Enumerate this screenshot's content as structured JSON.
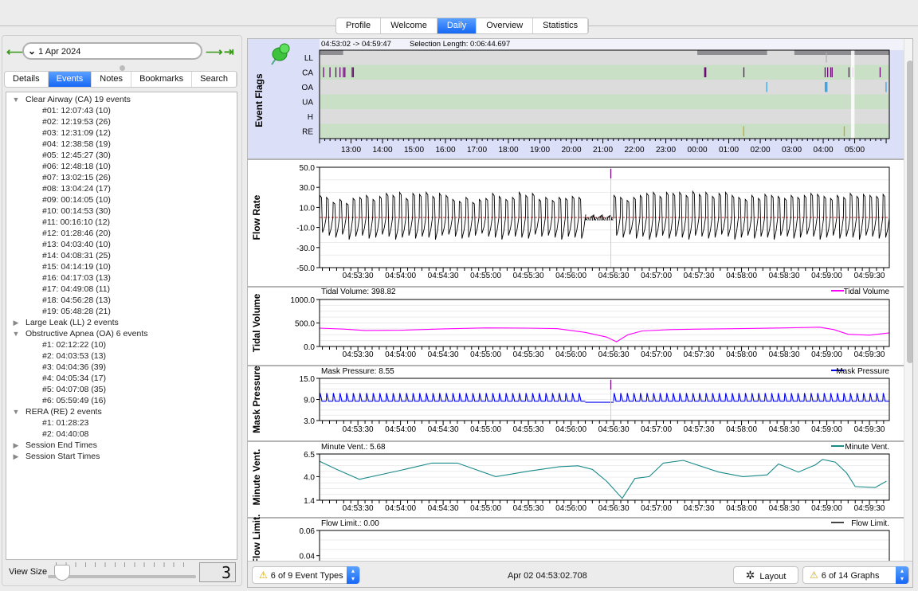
{
  "top_tabs": [
    {
      "label": "Profile"
    },
    {
      "label": "Welcome"
    },
    {
      "label": "Daily",
      "selected": true
    },
    {
      "label": "Overview"
    },
    {
      "label": "Statistics"
    }
  ],
  "left": {
    "date": "1 Apr 2024",
    "icons": {
      "prev": "arrow-left-icon",
      "next": "arrow-right-icon",
      "last": "arrow-to-end-icon",
      "dropdown": "chevron-down-icon"
    },
    "tabs": [
      {
        "label": "Details"
      },
      {
        "label": "Events",
        "selected": true
      },
      {
        "label": "Notes"
      },
      {
        "label": "Bookmarks"
      },
      {
        "label": "Search"
      }
    ],
    "tree": [
      {
        "label": "Clear Airway (CA) 19 events",
        "expanded": true,
        "children": [
          "#01: 12:07:43 (10)",
          "#02: 12:19:53 (26)",
          "#03: 12:31:09 (12)",
          "#04: 12:38:58 (19)",
          "#05: 12:45:27 (30)",
          "#06: 12:48:18 (10)",
          "#07: 13:02:15 (26)",
          "#08: 13:04:24 (17)",
          "#09: 00:14:05 (10)",
          "#10: 00:14:53 (30)",
          "#11: 00:16:10 (12)",
          "#12: 01:28:46 (20)",
          "#13: 04:03:40 (10)",
          "#14: 04:08:31 (25)",
          "#15: 04:14:19 (10)",
          "#16: 04:17:03 (13)",
          "#17: 04:49:08 (11)",
          "#18: 04:56:28 (13)",
          "#19: 05:48:28 (21)"
        ]
      },
      {
        "label": "Large Leak (LL) 2 events",
        "expanded": false,
        "children": []
      },
      {
        "label": "Obstructive Apnea (OA) 6 events",
        "expanded": true,
        "children": [
          "#1: 02:12:22 (10)",
          "#2: 04:03:53 (13)",
          "#3: 04:04:36 (39)",
          "#4: 04:05:34 (17)",
          "#5: 04:07:08 (35)",
          "#6: 05:59:49 (16)"
        ]
      },
      {
        "label": "RERA (RE) 2 events",
        "expanded": true,
        "children": [
          "#1: 01:28:23",
          "#2: 04:40:08"
        ]
      },
      {
        "label": "Session End Times",
        "expanded": false,
        "children": []
      },
      {
        "label": "Session Start Times",
        "expanded": false,
        "children": []
      }
    ],
    "view_size_label": "View Size",
    "view_size_value": "3"
  },
  "event_flags": {
    "title": "Event Flags",
    "range_text": "04:53:02 -> 04:59:47",
    "selection_text": "Selection Length: 0:06:44.697",
    "rows": [
      "LL",
      "CA",
      "OA",
      "UA",
      "H",
      "RE"
    ],
    "axis_range": [
      "12:00",
      "06:06"
    ],
    "ticks": [
      "13:00",
      "14:00",
      "15:00",
      "16:00",
      "17:00",
      "18:00",
      "19:00",
      "20:00",
      "21:00",
      "22:00",
      "23:00",
      "00:00",
      "01:00",
      "02:00",
      "03:00",
      "04:00",
      "05:00"
    ],
    "sessions": [
      [
        "12:01",
        "12:45"
      ],
      [
        "00:00",
        "02:13"
      ],
      [
        "03:05",
        "06:06"
      ]
    ],
    "selection": [
      "04:53:02",
      "04:59:47"
    ],
    "markers": {
      "LL": [
        "04:06:00"
      ],
      "CA": [
        "12:07:43",
        "12:19:53",
        "12:31:09",
        "12:38:58",
        "12:45:27",
        "12:48:18",
        "13:02:15",
        "13:04:24",
        "00:14:05",
        "00:14:53",
        "00:16:10",
        "01:28:46",
        "04:03:40",
        "04:08:31",
        "04:14:19",
        "04:17:03",
        "04:49:08",
        "04:56:28",
        "05:48:28"
      ],
      "OA": [
        "02:12:22",
        "04:03:53",
        "04:04:36",
        "04:05:34",
        "04:07:08",
        "05:59:49"
      ],
      "RE": [
        "01:28:23",
        "04:40:08"
      ]
    },
    "colors": {
      "LL": "#b0b0b0",
      "CA": "#6e0a78",
      "OA": "#3aa6e8",
      "RE": "#c8a81a",
      "row_gray": "#dcdcdc",
      "row_green": "#c9dfc6",
      "session": "#8e8e92"
    },
    "icon": "green-pushpin-icon"
  },
  "chart_data": [
    {
      "type": "line",
      "id": "flow",
      "ylabel": "Flow Rate",
      "header": "",
      "legend": "",
      "color": "#000000",
      "ylim": [
        -50,
        50
      ],
      "yticks": [
        "50.0",
        "30.0",
        "10.0",
        "-10.0",
        "-30.0",
        "-50.0"
      ],
      "xlim": [
        "04:53:03",
        "04:59:44"
      ],
      "xticks": [
        "04:53:30",
        "04:54:00",
        "04:54:30",
        "04:55:00",
        "04:55:30",
        "04:56:00",
        "04:56:30",
        "04:57:00",
        "04:57:30",
        "04:58:00",
        "04:58:30",
        "04:59:00",
        "04:59:30"
      ],
      "zero_line_color": "#d03030",
      "event_marker": {
        "time": "04:56:28",
        "color": "#6e0a78"
      },
      "segments": [
        {
          "from": "04:53:03",
          "to": "04:56:10",
          "peaks": [
            22,
            20,
            15,
            18,
            14,
            19,
            20,
            22,
            18,
            21,
            24,
            22,
            25,
            19,
            24,
            23,
            25,
            21,
            24,
            22,
            18,
            16,
            20,
            15,
            18,
            19,
            24,
            21,
            18,
            20,
            25,
            22,
            24,
            18,
            20,
            17,
            20,
            19,
            21,
            20
          ],
          "troughs": [
            -15,
            -18,
            -20,
            -17,
            -22,
            -19,
            -18,
            -21,
            -20,
            -17,
            -19,
            -22,
            -20,
            -18,
            -21,
            -19,
            -20,
            -22,
            -18,
            -17,
            -19,
            -21,
            -20,
            -18,
            -16,
            -19,
            -20,
            -22,
            -18,
            -19,
            -20,
            -21,
            -17,
            -19,
            -18,
            -20,
            -22,
            -19,
            -20,
            -21
          ]
        },
        {
          "from": "04:56:30",
          "to": "04:59:44",
          "peaks": [
            22,
            20,
            17,
            20,
            22,
            24,
            25,
            21,
            25,
            24,
            25,
            22,
            26,
            23,
            25,
            21,
            24,
            25,
            22,
            20,
            18,
            22,
            19,
            23,
            22,
            21,
            19,
            22,
            20,
            22,
            24,
            23,
            21,
            19,
            22,
            20,
            24,
            21,
            23,
            22,
            21,
            23
          ],
          "troughs": [
            -18,
            -20,
            -17,
            -21,
            -19,
            -22,
            -20,
            -18,
            -21,
            -19,
            -20,
            -22,
            -18,
            -19,
            -21,
            -20,
            -17,
            -19,
            -22,
            -20,
            -18,
            -21,
            -19,
            -20,
            -22,
            -18,
            -19,
            -21,
            -20,
            -17,
            -19,
            -22,
            -20,
            -18,
            -21,
            -19,
            -20,
            -22,
            -18,
            -19,
            -21,
            -20
          ]
        }
      ],
      "apnea": {
        "from": "04:56:10",
        "to": "04:56:30",
        "amplitude": 3
      }
    },
    {
      "type": "line",
      "id": "tv",
      "ylabel": "Tidal Volume",
      "header": "Tidal Volume: 398.82",
      "legend": "Tidal Volume",
      "color": "#ff00ff",
      "ylim": [
        0,
        1000
      ],
      "yticks": [
        "1000.0",
        "500.0",
        "0.0"
      ],
      "xlim": [
        "04:53:03",
        "04:59:44"
      ],
      "points": [
        [
          "04:53:03",
          390
        ],
        [
          "04:53:20",
          370
        ],
        [
          "04:53:35",
          340
        ],
        [
          "04:54:00",
          345
        ],
        [
          "04:54:30",
          375
        ],
        [
          "04:55:00",
          395
        ],
        [
          "04:55:30",
          390
        ],
        [
          "04:55:50",
          380
        ],
        [
          "04:56:10",
          300
        ],
        [
          "04:56:25",
          200
        ],
        [
          "04:56:32",
          100
        ],
        [
          "04:56:40",
          250
        ],
        [
          "04:56:50",
          330
        ],
        [
          "04:57:10",
          360
        ],
        [
          "04:57:30",
          370
        ],
        [
          "04:58:00",
          380
        ],
        [
          "04:58:30",
          395
        ],
        [
          "04:58:55",
          410
        ],
        [
          "04:59:05",
          360
        ],
        [
          "04:59:15",
          260
        ],
        [
          "04:59:30",
          240
        ],
        [
          "04:59:44",
          290
        ]
      ]
    },
    {
      "type": "line",
      "id": "mp",
      "ylabel": "Mask Pressure",
      "header": "Mask Pressure: 8.55",
      "legend": "Mask Pressure",
      "color": "#0000ee",
      "ylim": [
        3,
        15
      ],
      "yticks": [
        "15.0",
        "9.0",
        "3.0"
      ],
      "xlim": [
        "04:53:03",
        "04:59:44"
      ],
      "baseline": 8.5,
      "peak": 10.8,
      "apnea_level": 8.2,
      "event_marker": {
        "time": "04:56:28",
        "color": "#6e0a78"
      }
    },
    {
      "type": "line",
      "id": "mv",
      "ylabel": "Minute Vent.",
      "header": "Minute Vent.: 5.68",
      "legend": "Minute Vent.",
      "color": "#1a8a8a",
      "ylim": [
        1.4,
        6.5
      ],
      "yticks": [
        "6.5",
        "4.0",
        "1.4"
      ],
      "xlim": [
        "04:53:03",
        "04:59:44"
      ],
      "points": [
        [
          "04:53:03",
          5.7
        ],
        [
          "04:53:15",
          4.8
        ],
        [
          "04:53:31",
          3.7
        ],
        [
          "04:54:00",
          4.7
        ],
        [
          "04:54:22",
          5.5
        ],
        [
          "04:54:40",
          5.5
        ],
        [
          "04:55:07",
          4.0
        ],
        [
          "04:55:30",
          4.6
        ],
        [
          "04:55:52",
          5.1
        ],
        [
          "04:56:05",
          5.2
        ],
        [
          "04:56:15",
          4.8
        ],
        [
          "04:56:25",
          3.5
        ],
        [
          "04:56:36",
          1.6
        ],
        [
          "04:56:45",
          3.8
        ],
        [
          "04:56:55",
          4.0
        ],
        [
          "04:57:05",
          5.5
        ],
        [
          "04:57:19",
          5.8
        ],
        [
          "04:57:44",
          4.5
        ],
        [
          "04:58:01",
          4.0
        ],
        [
          "04:58:18",
          4.2
        ],
        [
          "04:58:26",
          5.4
        ],
        [
          "04:58:40",
          4.5
        ],
        [
          "04:58:52",
          5.3
        ],
        [
          "04:58:57",
          5.9
        ],
        [
          "04:59:06",
          5.6
        ],
        [
          "04:59:14",
          4.4
        ],
        [
          "04:59:20",
          2.9
        ],
        [
          "04:59:34",
          2.8
        ],
        [
          "04:59:42",
          3.5
        ]
      ]
    },
    {
      "type": "line",
      "id": "fl",
      "ylabel": "Flow Limit.",
      "header": "Flow Limit.: 0.00",
      "legend": "Flow Limit.",
      "color": "#444444",
      "ylim": [
        0,
        0.06
      ],
      "yticks": [
        "0.06",
        "0.04"
      ],
      "xlim": [
        "04:53:03",
        "04:59:44"
      ],
      "points": [
        [
          "04:53:03",
          0
        ],
        [
          "04:59:44",
          0
        ]
      ]
    }
  ],
  "bottom": {
    "event_types": "6 of 9 Event Types",
    "timestamp": "Apr 02 04:53:02.708",
    "layout": "Layout",
    "graphs": "6 of 14 Graphs",
    "icons": {
      "warning": "warning-icon",
      "layout": "gear-icon",
      "updown": "up-down-chevron-icon"
    }
  }
}
